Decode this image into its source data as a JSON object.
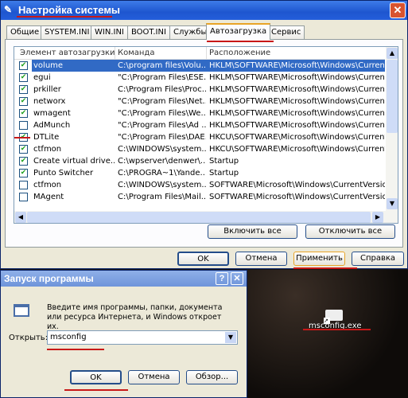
{
  "msconfig": {
    "title": "Настройка системы",
    "tabs": [
      "Общие",
      "SYSTEM.INI",
      "WIN.INI",
      "BOOT.INI",
      "Службы",
      "Автозагрузка",
      "Сервис"
    ],
    "active_tab": "Автозагрузка",
    "columns": [
      "Элемент автозагрузки",
      "Команда",
      "Расположение"
    ],
    "rows": [
      {
        "checked": true,
        "name": "volume",
        "command": "C:\\program files\\Volu...",
        "location": "HKLM\\SOFTWARE\\Microsoft\\Windows\\CurrentVer.",
        "selected": true
      },
      {
        "checked": true,
        "name": "egui",
        "command": "\"C:\\Program Files\\ESE...",
        "location": "HKLM\\SOFTWARE\\Microsoft\\Windows\\CurrentVer."
      },
      {
        "checked": true,
        "name": "prkiller",
        "command": "C:\\Program Files\\Proc...",
        "location": "HKLM\\SOFTWARE\\Microsoft\\Windows\\CurrentVer."
      },
      {
        "checked": true,
        "name": "networx",
        "command": "\"C:\\Program Files\\Net...",
        "location": "HKLM\\SOFTWARE\\Microsoft\\Windows\\CurrentVer."
      },
      {
        "checked": true,
        "name": "wmagent",
        "command": "\"C:\\Program Files\\We...",
        "location": "HKLM\\SOFTWARE\\Microsoft\\Windows\\CurrentVer."
      },
      {
        "checked": false,
        "name": "AdMunch",
        "command": "\"C:\\Program Files\\Ad ...",
        "location": "HKLM\\SOFTWARE\\Microsoft\\Windows\\CurrentVer."
      },
      {
        "checked": true,
        "name": "DTLite",
        "command": "\"C:\\Program Files\\DAE...",
        "location": "HKCU\\SOFTWARE\\Microsoft\\Windows\\CurrentVer."
      },
      {
        "checked": true,
        "name": "ctfmon",
        "command": "C:\\WINDOWS\\system...",
        "location": "HKCU\\SOFTWARE\\Microsoft\\Windows\\CurrentVer."
      },
      {
        "checked": true,
        "name": "Create virtual drive...",
        "command": "C:\\wpserver\\denwer\\...",
        "location": "Startup"
      },
      {
        "checked": true,
        "name": "Punto Switcher",
        "command": "C:\\PROGRA~1\\Yande...",
        "location": "Startup"
      },
      {
        "checked": false,
        "name": "ctfmon",
        "command": "C:\\WINDOWS\\system...",
        "location": "SOFTWARE\\Microsoft\\Windows\\CurrentVersion\\Ru"
      },
      {
        "checked": false,
        "name": "MAgent",
        "command": "C:\\Program Files\\Mail....",
        "location": "SOFTWARE\\Microsoft\\Windows\\CurrentVersion\\Ru"
      }
    ],
    "enable_all": "Включить все",
    "disable_all": "Отключить все",
    "ok": "OK",
    "cancel": "Отмена",
    "apply": "Применить",
    "help": "Справка"
  },
  "run": {
    "title": "Запуск программы",
    "help_btn": "?",
    "description": "Введите имя программы, папки, документа или ресурса Интернета, и Windows откроет их.",
    "open_label": "Открыть:",
    "open_value": "msconfig",
    "ok": "OK",
    "cancel": "Отмена",
    "browse": "Обзор..."
  },
  "desktop": {
    "icon_label": "msconfig.exe"
  },
  "colors": {
    "highlight": "#c81818",
    "selection": "#316ac5"
  }
}
